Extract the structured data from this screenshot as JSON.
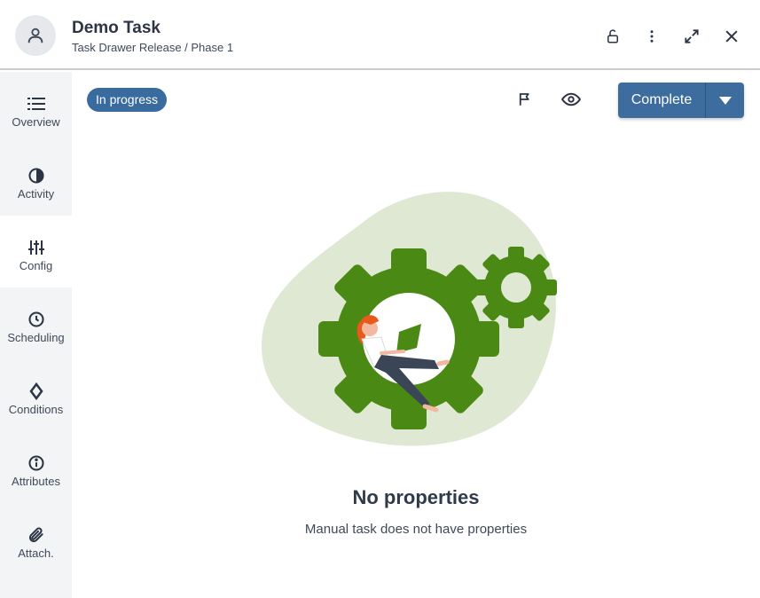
{
  "header": {
    "title": "Demo Task",
    "subtitle": "Task Drawer Release / Phase 1",
    "icons": [
      "user-icon",
      "unlock-icon",
      "more-vert-icon",
      "expand-icon",
      "close-icon"
    ]
  },
  "sidebar": {
    "items": [
      {
        "label": "Overview",
        "icon": "list-icon"
      },
      {
        "label": "Activity",
        "icon": "pie-icon"
      },
      {
        "label": "Config",
        "icon": "sliders-icon",
        "active": true
      },
      {
        "label": "Scheduling",
        "icon": "clock-icon"
      },
      {
        "label": "Conditions",
        "icon": "diamond-icon"
      },
      {
        "label": "Attributes",
        "icon": "info-icon"
      },
      {
        "label": "Attach.",
        "icon": "paperclip-icon"
      }
    ]
  },
  "toolbar": {
    "status": "In progress",
    "flag_icon": "flag-icon",
    "watch_icon": "eye-icon",
    "complete_label": "Complete"
  },
  "empty_state": {
    "title": "No properties",
    "message": "Manual task does not have properties"
  },
  "colors": {
    "accent": "#3d6c9e",
    "gear": "#4a8a14",
    "blob": "#dfe8d3",
    "sidebar_bg": "#f3f4f6"
  }
}
